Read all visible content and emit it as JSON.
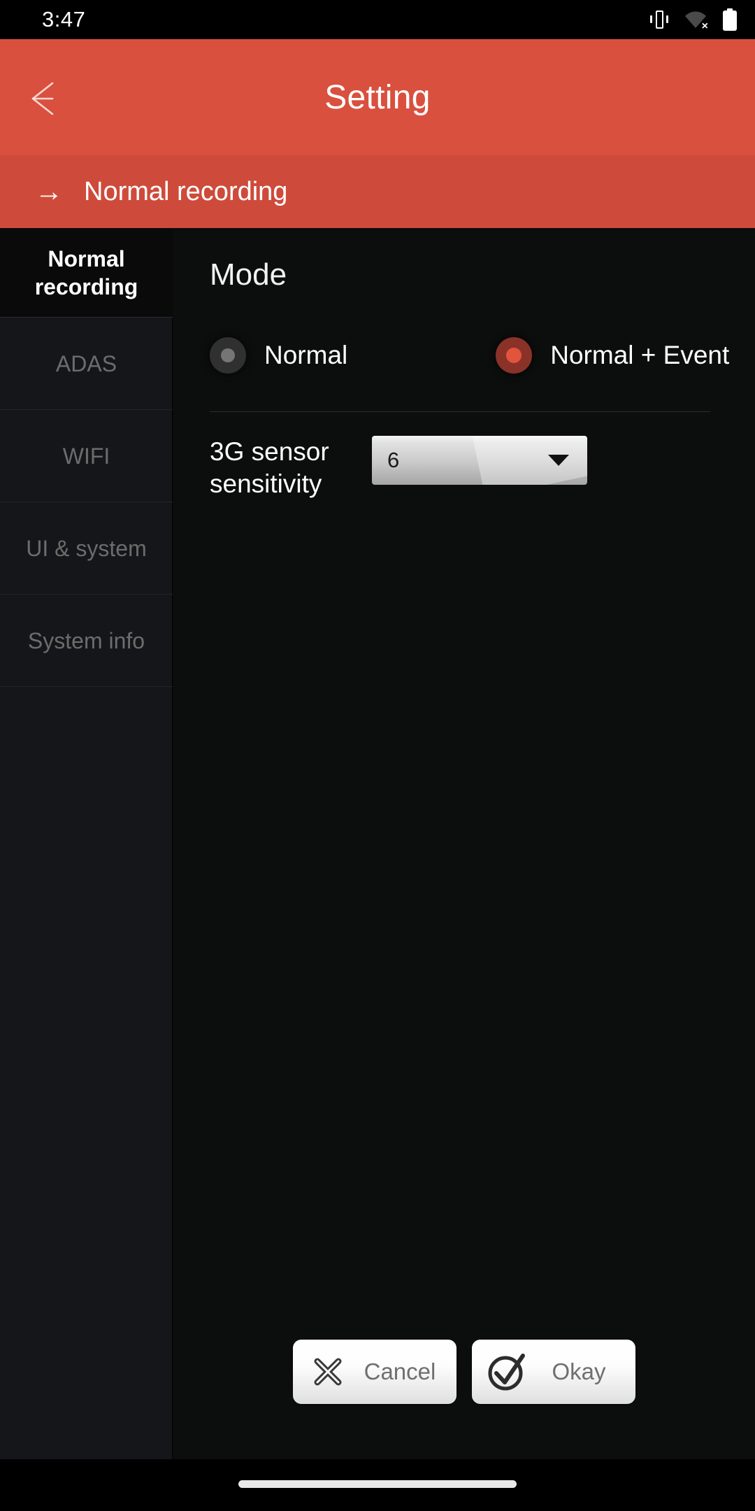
{
  "status_bar": {
    "clock": "3:47",
    "icons": [
      "vibrate-icon",
      "wifi-off-icon",
      "battery-icon"
    ]
  },
  "app_bar": {
    "back_icon": "back-arrow-icon",
    "title": "Setting"
  },
  "breadcrumb": {
    "arrow": "→",
    "label": "Normal recording"
  },
  "sidebar": {
    "items": [
      {
        "label": "Normal recording",
        "active": true
      },
      {
        "label": "ADAS",
        "active": false
      },
      {
        "label": "WIFI",
        "active": false
      },
      {
        "label": "UI & system",
        "active": false
      },
      {
        "label": "System info",
        "active": false
      }
    ]
  },
  "main": {
    "section_title": "Mode",
    "mode_options": [
      {
        "label": "Normal",
        "selected": false
      },
      {
        "label": "Normal + Event",
        "selected": true
      }
    ],
    "sensitivity": {
      "label": "3G sensor sensitivity",
      "label_line1": "3G sensor",
      "label_line2": "sensitivity",
      "value": "6",
      "caret_icon": "chevron-down-icon"
    }
  },
  "footer": {
    "cancel": {
      "label": "Cancel",
      "icon": "close-x-icon"
    },
    "okay": {
      "label": "Okay",
      "icon": "check-circle-icon"
    }
  },
  "colors": {
    "accent": "#d9503e",
    "accent_dark": "#ce4b3b",
    "sidebar_bg": "#141619",
    "main_bg": "#0c0d0d",
    "radio_selected_inner": "#e3543c",
    "radio_selected_outer": "#8a3228"
  }
}
